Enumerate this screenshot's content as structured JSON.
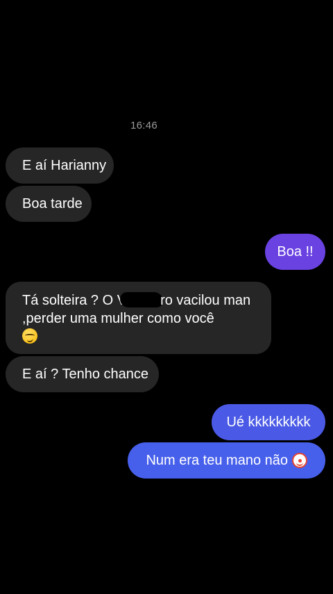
{
  "timestamp": "16:46",
  "messages": [
    {
      "direction": "incoming",
      "text": "E aí Harianny"
    },
    {
      "direction": "incoming",
      "text": "Boa tarde"
    },
    {
      "direction": "outgoing",
      "text": "Boa !!"
    },
    {
      "direction": "incoming",
      "text_before": "Tá solteira ? O V",
      "text_after": "ro vacilou man ,perder uma mulher como você",
      "redacted": true,
      "emoji": "smirking-face-emoji"
    },
    {
      "direction": "incoming",
      "text": "E aí ? Tenho chance"
    },
    {
      "direction": "outgoing",
      "text": "Ué kkkkkkkkk"
    },
    {
      "direction": "outgoing",
      "text": "Num era teu mano não",
      "emoji": "clown-face-emoji"
    }
  ],
  "colors": {
    "background": "#000000",
    "incoming_bubble": "#262626",
    "outgoing_purple": "#6a42e2",
    "outgoing_blue": "#4760eb",
    "timestamp": "#9a9a9a"
  }
}
